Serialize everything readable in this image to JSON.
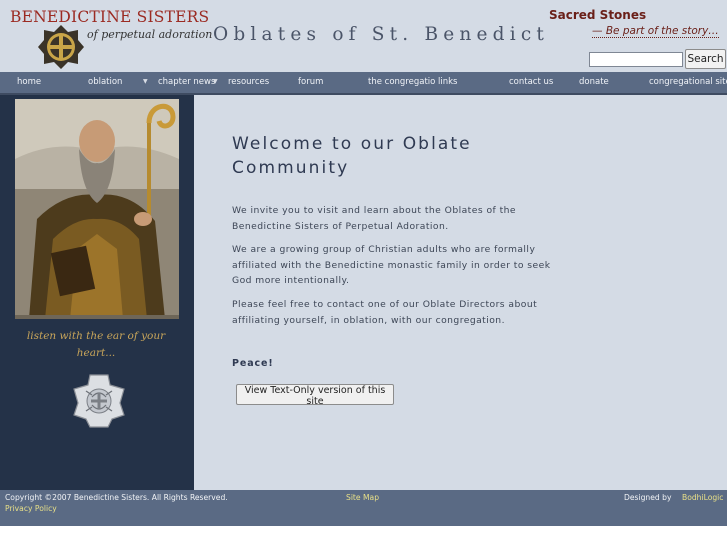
{
  "header": {
    "logo_line1": "BENEDICTINE SISTERS",
    "logo_line2": "of perpetual adoration",
    "site_title": "Oblates of St. Benedict",
    "promo_title": "Sacred Stones",
    "promo_subtitle": "— Be part of the story…",
    "search_placeholder": "",
    "search_button": "Search"
  },
  "nav": {
    "items": [
      {
        "label": "home"
      },
      {
        "label": "oblation",
        "dropdown": true
      },
      {
        "label": "chapter news",
        "dropdown": true
      },
      {
        "label": "resources"
      },
      {
        "label": "forum"
      },
      {
        "label": "the congregation"
      },
      {
        "label": "links"
      },
      {
        "label": "contact us"
      },
      {
        "label": "donate"
      },
      {
        "label": "congregational site"
      }
    ]
  },
  "sidebar": {
    "motto": "listen with the ear of your heart..."
  },
  "main": {
    "heading": "Welcome to our Oblate Community",
    "paragraphs": [
      "We invite you to visit and learn about the Oblates of the Benedictine Sisters of Perpetual Adoration.",
      "We are a growing group of Christian adults who are formally affiliated with the Benedictine monastic family in order to seek God more intentionally.",
      "Please feel free to contact one of our Oblate Directors about affiliating yourself, in oblation, with our congregation."
    ],
    "closing": "Peace!",
    "text_only_button": "View Text-Only version of this site"
  },
  "footer": {
    "copyright": "Copyright ©2007 Benedictine Sisters. All Rights Reserved.",
    "privacy": "Privacy Policy",
    "sitemap": "Site Map",
    "designed_by_label": "Designed by",
    "designer": "BodhiLogic"
  },
  "colors": {
    "header_bg": "#d4dbe5",
    "nav_bg": "#5a6a84",
    "sidebar_bg": "#243248",
    "brand_red": "#9b2a22",
    "footer_link": "#e8e088"
  },
  "icons": [
    "medal-logo-icon",
    "cross-medal-icon",
    "chevron-down-icon"
  ]
}
